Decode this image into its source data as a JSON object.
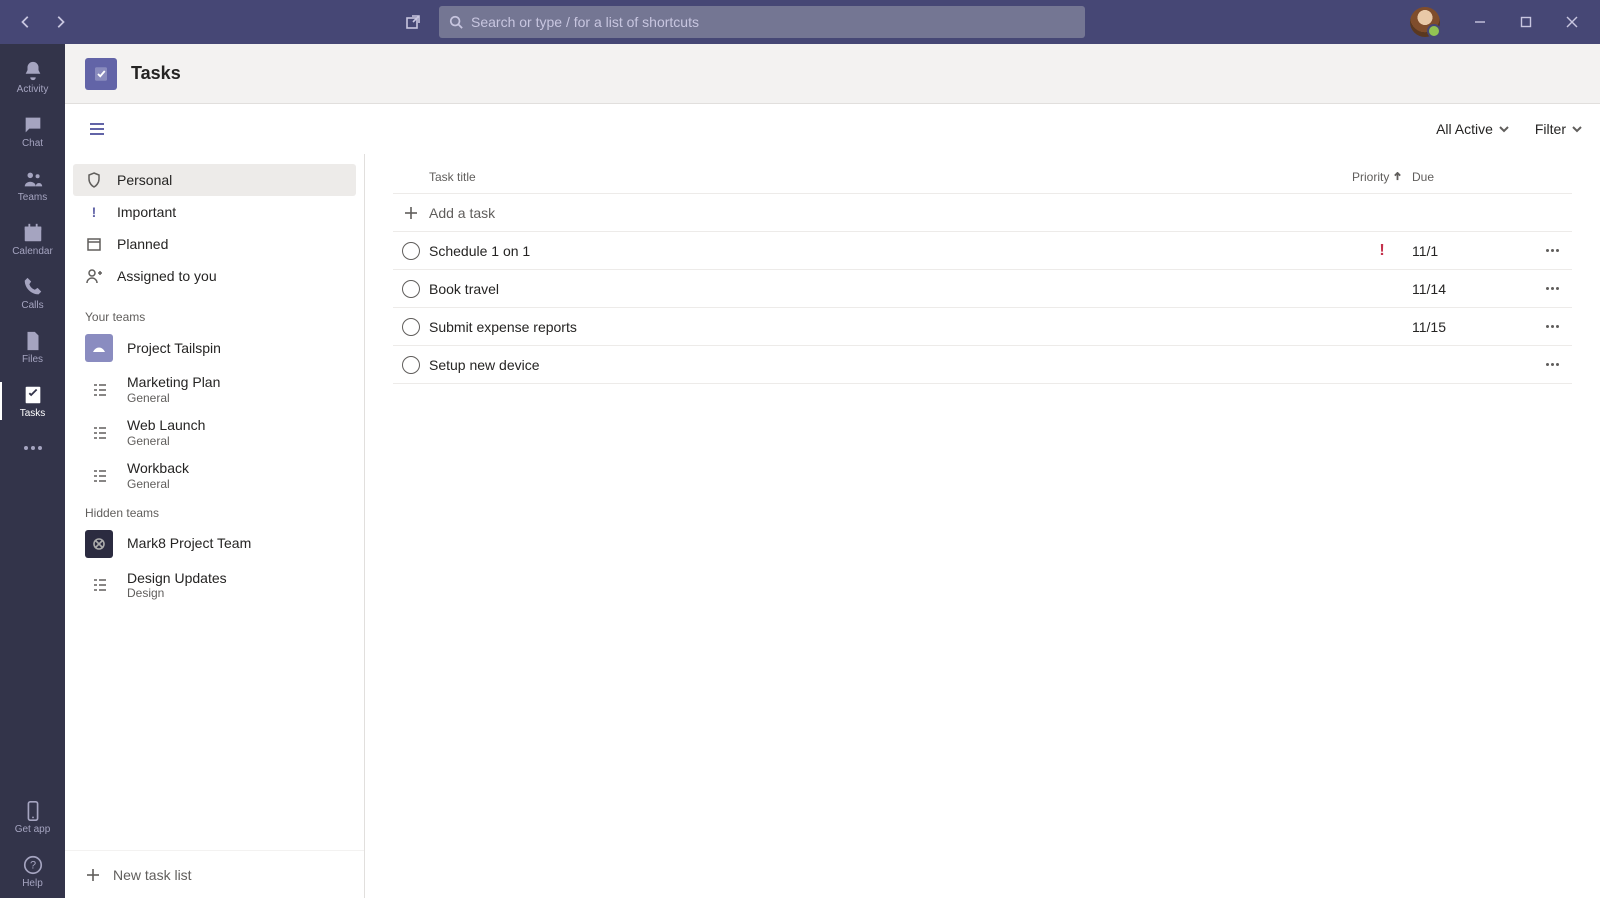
{
  "search": {
    "placeholder": "Search or type / for a list of shortcuts"
  },
  "rail": {
    "items": [
      {
        "label": "Activity"
      },
      {
        "label": "Chat"
      },
      {
        "label": "Teams"
      },
      {
        "label": "Calendar"
      },
      {
        "label": "Calls"
      },
      {
        "label": "Files"
      },
      {
        "label": "Tasks"
      }
    ],
    "getapp": "Get app",
    "help": "Help"
  },
  "header": {
    "title": "Tasks"
  },
  "toolbar": {
    "view": "All Active",
    "filter": "Filter"
  },
  "sidepanel": {
    "smart": [
      {
        "label": "Personal"
      },
      {
        "label": "Important"
      },
      {
        "label": "Planned"
      },
      {
        "label": "Assigned to you"
      }
    ],
    "section_yourteams": "Your teams",
    "yourteams": [
      {
        "name": "Project Tailspin",
        "channel": ""
      },
      {
        "name": "Marketing Plan",
        "channel": "General"
      },
      {
        "name": "Web Launch",
        "channel": "General"
      },
      {
        "name": "Workback",
        "channel": "General"
      }
    ],
    "section_hidden": "Hidden teams",
    "hidden": [
      {
        "name": "Mark8 Project Team",
        "channel": ""
      },
      {
        "name": "Design Updates",
        "channel": "Design"
      }
    ],
    "newlist": "New task list"
  },
  "table": {
    "cols": {
      "title": "Task title",
      "priority": "Priority",
      "due": "Due"
    },
    "add_label": "Add a task",
    "rows": [
      {
        "title": "Schedule 1 on 1",
        "priority": "high",
        "due": "11/1"
      },
      {
        "title": "Book travel",
        "priority": "",
        "due": "11/14"
      },
      {
        "title": "Submit expense reports",
        "priority": "",
        "due": "11/15"
      },
      {
        "title": "Setup new device",
        "priority": "",
        "due": ""
      }
    ]
  }
}
